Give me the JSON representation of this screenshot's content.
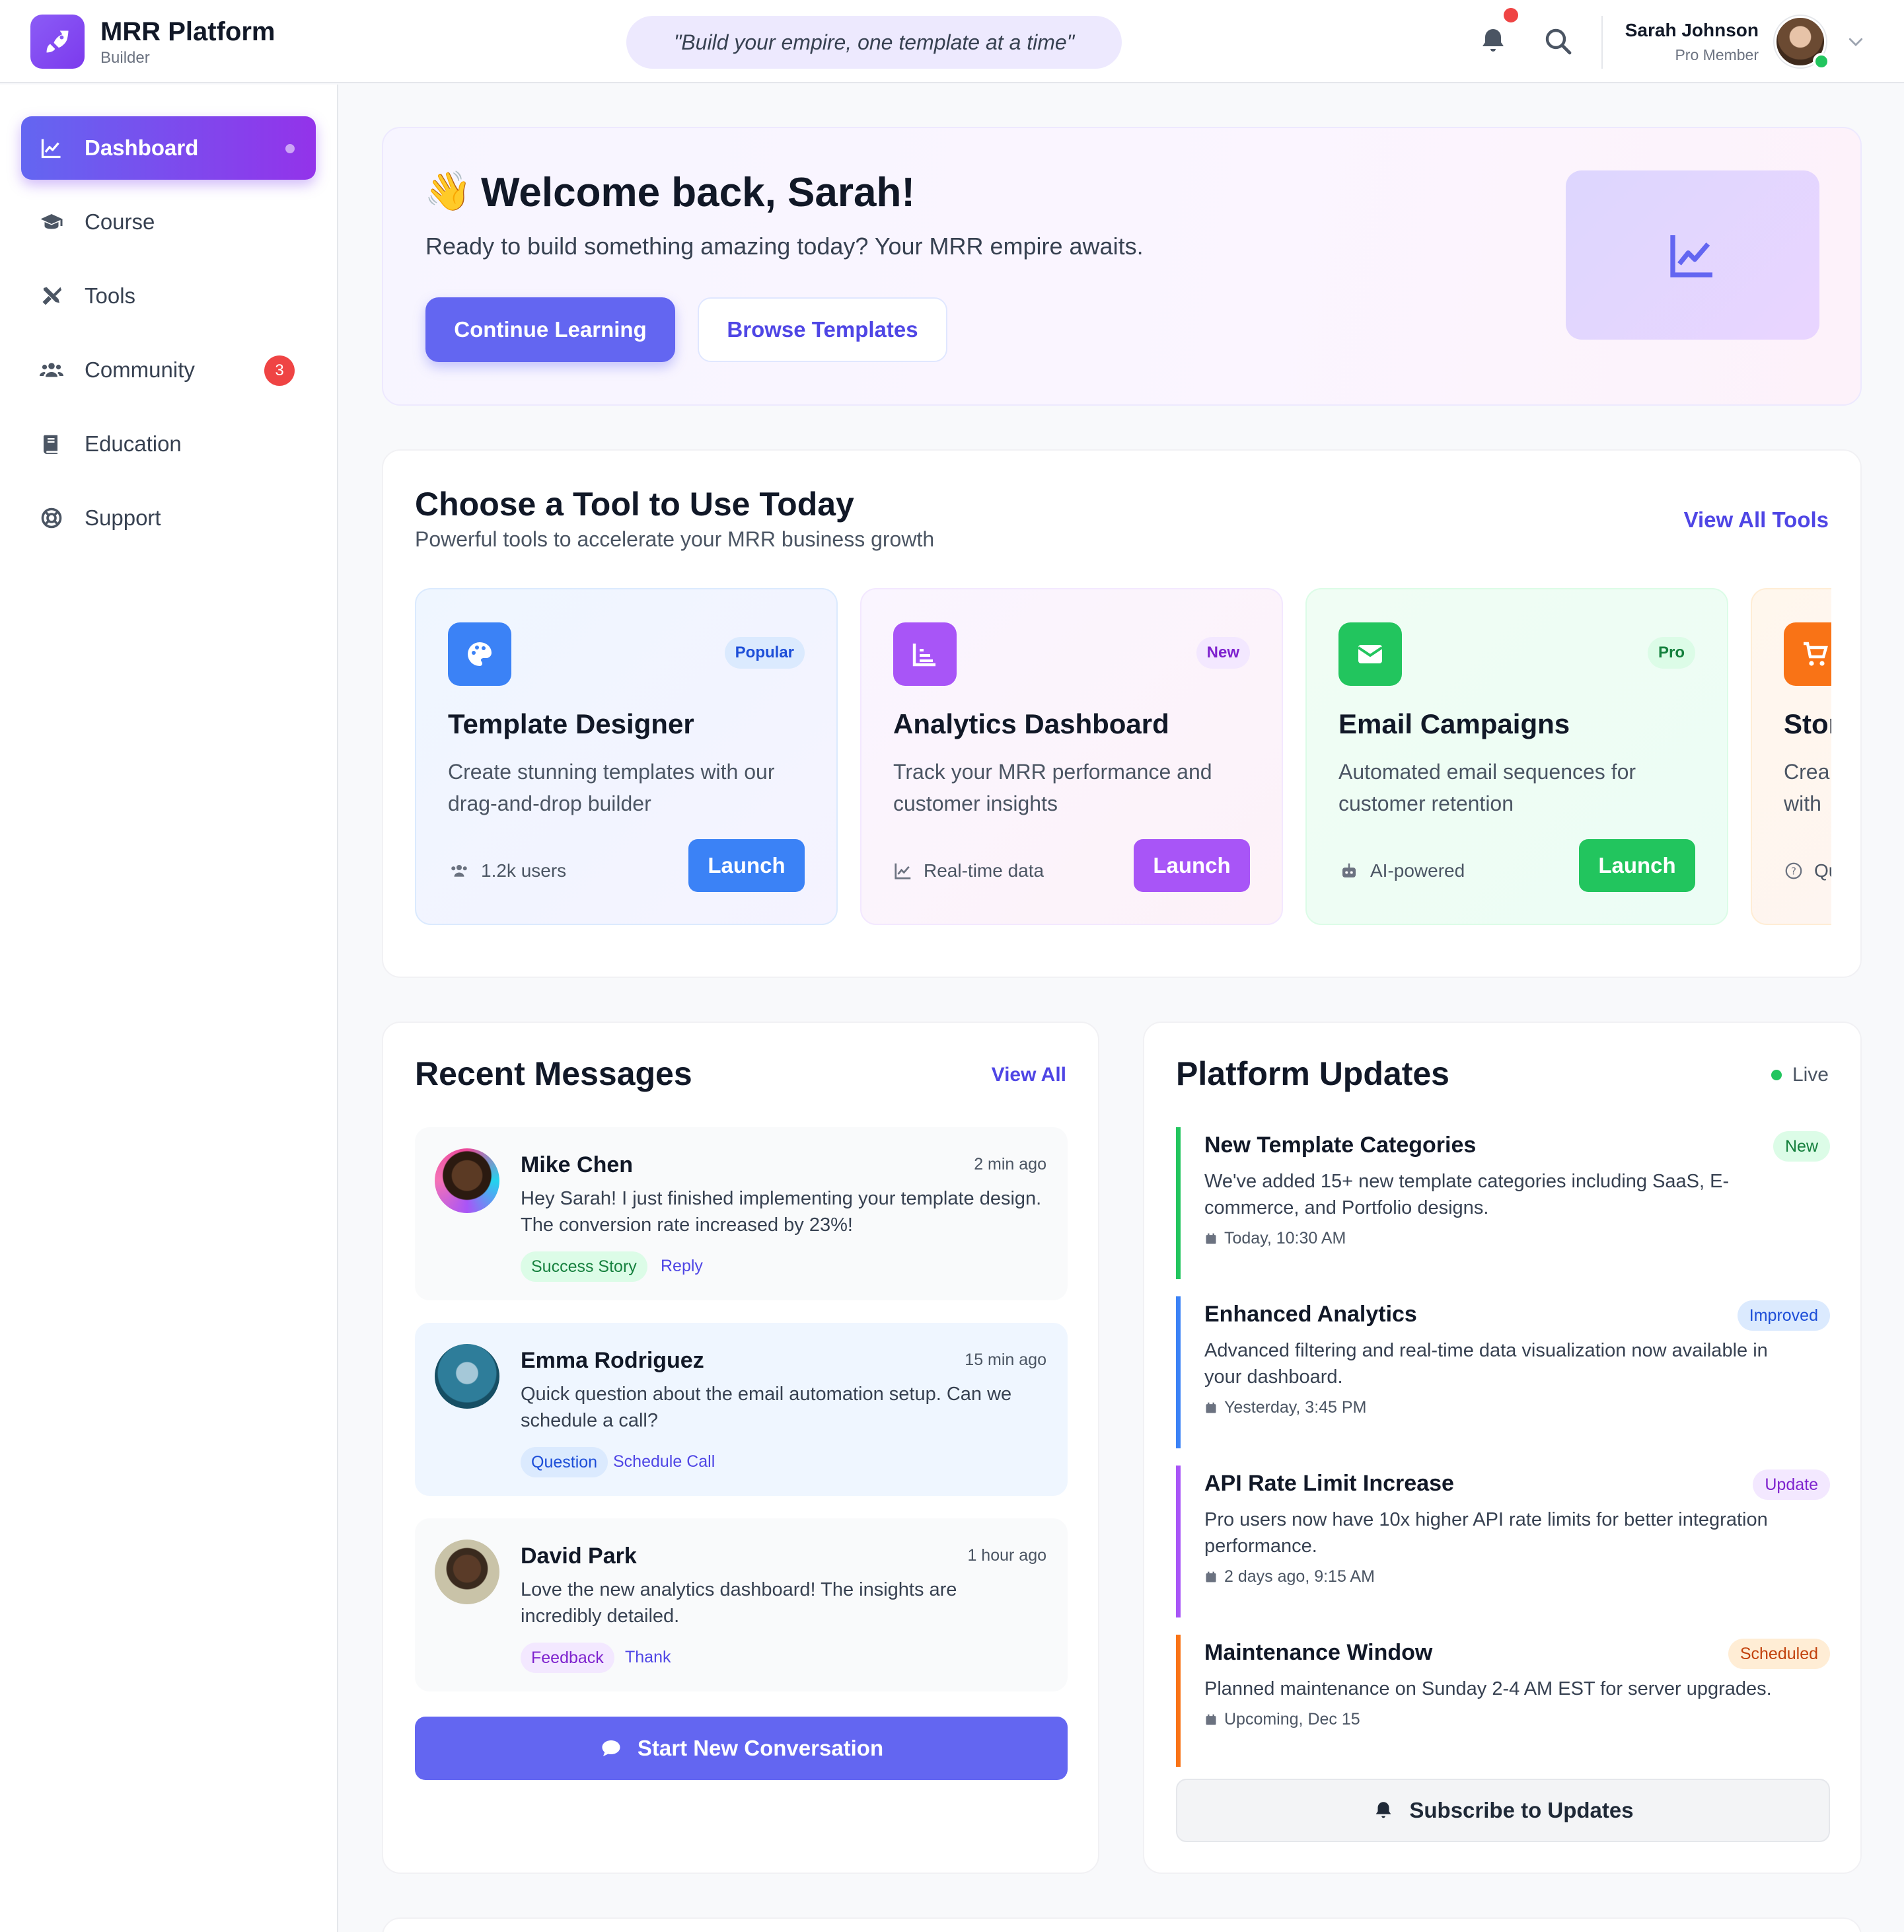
{
  "brand": {
    "title": "MRR Platform",
    "subtitle": "Builder"
  },
  "header": {
    "quote": "\"Build your empire, one template at a time\"",
    "user_name": "Sarah Johnson",
    "user_role": "Pro Member"
  },
  "sidebar": {
    "items": [
      {
        "label": "Dashboard",
        "icon": "chart-line-icon",
        "active": true
      },
      {
        "label": "Course",
        "icon": "graduation-cap-icon"
      },
      {
        "label": "Tools",
        "icon": "tools-icon"
      },
      {
        "label": "Community",
        "icon": "users-icon",
        "badge": "3"
      },
      {
        "label": "Education",
        "icon": "book-icon"
      },
      {
        "label": "Support",
        "icon": "life-ring-icon"
      }
    ]
  },
  "welcome": {
    "emoji": "👋",
    "title": "Welcome back, Sarah!",
    "subtitle": "Ready to build something amazing today? Your MRR empire awaits.",
    "primary_button": "Continue Learning",
    "secondary_button": "Browse Templates"
  },
  "tools": {
    "title": "Choose a Tool to Use Today",
    "subtitle": "Powerful tools to accelerate your MRR business growth",
    "view_all": "View All Tools",
    "cards": [
      {
        "name": "Template Designer",
        "badge": "Popular",
        "desc": "Create stunning templates with our drag-and-drop builder",
        "meta": "1.2k users",
        "launch": "Launch",
        "accent": "#3b82f6"
      },
      {
        "name": "Analytics Dashboard",
        "badge": "New",
        "desc": "Track your MRR performance and customer insights",
        "meta": "Real-time data",
        "launch": "Launch",
        "accent": "#a855f7"
      },
      {
        "name": "Email Campaigns",
        "badge": "Pro",
        "desc": "Automated email sequences for customer retention",
        "meta": "AI-powered",
        "launch": "Launch",
        "accent": "#22c55e"
      },
      {
        "name": "Stor",
        "badge": "",
        "desc": "Crea with",
        "meta": "Qu",
        "launch": "",
        "accent": "#f97316"
      }
    ]
  },
  "messages": {
    "title": "Recent Messages",
    "view_all": "View All",
    "start_button": "Start New Conversation",
    "items": [
      {
        "name": "Mike Chen",
        "time": "2 min ago",
        "text": "Hey Sarah! I just finished implementing your template design. The conversion rate increased by 23%!",
        "tag": "Success Story",
        "action": "Reply"
      },
      {
        "name": "Emma Rodriguez",
        "time": "15 min ago",
        "text": "Quick question about the email automation setup. Can we schedule a call?",
        "tag": "Question",
        "action": "Schedule Call"
      },
      {
        "name": "David Park",
        "time": "1 hour ago",
        "text": "Love the new analytics dashboard! The insights are incredibly detailed.",
        "tag": "Feedback",
        "action": "Thank"
      }
    ]
  },
  "updates": {
    "title": "Platform Updates",
    "live": "Live",
    "subscribe_button": "Subscribe to Updates",
    "items": [
      {
        "title": "New Template Categories",
        "badge": "New",
        "desc": "We've added 15+ new template categories including SaaS, E-commerce, and Portfolio designs.",
        "date": "Today, 10:30 AM",
        "color": "#22c55e"
      },
      {
        "title": "Enhanced Analytics",
        "badge": "Improved",
        "desc": "Advanced filtering and real-time data visualization now available in your dashboard.",
        "date": "Yesterday, 3:45 PM",
        "color": "#3b82f6"
      },
      {
        "title": "API Rate Limit Increase",
        "badge": "Update",
        "desc": "Pro users now have 10x higher API rate limits for better integration performance.",
        "date": "2 days ago, 9:15 AM",
        "color": "#a855f7"
      },
      {
        "title": "Maintenance Window",
        "badge": "Scheduled",
        "desc": "Planned maintenance on Sunday 2-4 AM EST for server upgrades.",
        "date": "Upcoming, Dec 15",
        "color": "#f97316"
      }
    ]
  }
}
